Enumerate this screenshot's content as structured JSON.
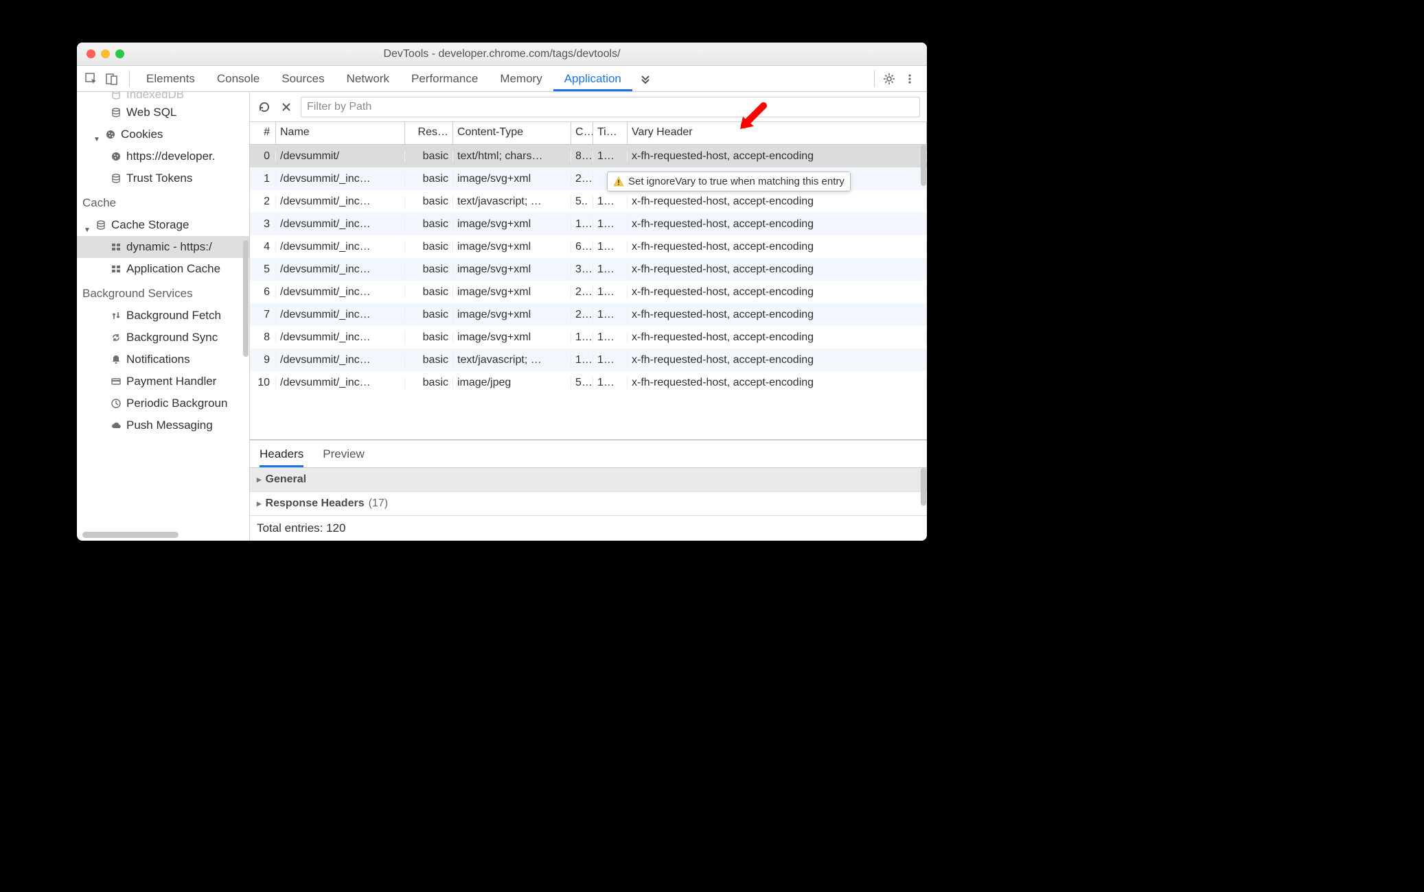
{
  "window_title": "DevTools - developer.chrome.com/tags/devtools/",
  "tabs": [
    "Elements",
    "Console",
    "Sources",
    "Network",
    "Performance",
    "Memory",
    "Application"
  ],
  "active_tab": "Application",
  "sidebar": {
    "truncated_top": "IndexedDB",
    "items_storage": [
      {
        "icon": "db",
        "label": "Web SQL"
      },
      {
        "icon": "cookie",
        "label": "Cookies",
        "expandable": true,
        "children": [
          {
            "icon": "cookie",
            "label": "https://developer."
          }
        ]
      },
      {
        "icon": "db",
        "label": "Trust Tokens"
      }
    ],
    "section_cache": "Cache",
    "cache_items": [
      {
        "icon": "db",
        "label": "Cache Storage",
        "expandable": true,
        "children": [
          {
            "icon": "grid",
            "label": "dynamic - https:/",
            "selected": true
          }
        ]
      },
      {
        "icon": "grid",
        "label": "Application Cache"
      }
    ],
    "section_bg": "Background Services",
    "bg_items": [
      {
        "icon": "updown",
        "label": "Background Fetch"
      },
      {
        "icon": "sync",
        "label": "Background Sync"
      },
      {
        "icon": "bell",
        "label": "Notifications"
      },
      {
        "icon": "card",
        "label": "Payment Handler"
      },
      {
        "icon": "clock",
        "label": "Periodic Backgroun"
      },
      {
        "icon": "cloud",
        "label": "Push Messaging"
      }
    ]
  },
  "filter_placeholder": "Filter by Path",
  "columns": [
    "#",
    "Name",
    "Res…",
    "Content-Type",
    "C..",
    "Ti…",
    "Vary Header"
  ],
  "rows": [
    {
      "n": "0",
      "name": "/devsummit/",
      "res": "basic",
      "ct": "text/html; chars…",
      "c": "8…",
      "t": "1…",
      "vary": "x-fh-requested-host, accept-encoding",
      "sel": true
    },
    {
      "n": "1",
      "name": "/devsummit/_inc…",
      "res": "basic",
      "ct": "image/svg+xml",
      "c": "2…",
      "t": "",
      "vary": ""
    },
    {
      "n": "2",
      "name": "/devsummit/_inc…",
      "res": "basic",
      "ct": "text/javascript; …",
      "c": "5..",
      "t": "1…",
      "vary": "x-fh-requested-host, accept-encoding"
    },
    {
      "n": "3",
      "name": "/devsummit/_inc…",
      "res": "basic",
      "ct": "image/svg+xml",
      "c": "1…",
      "t": "1…",
      "vary": "x-fh-requested-host, accept-encoding"
    },
    {
      "n": "4",
      "name": "/devsummit/_inc…",
      "res": "basic",
      "ct": "image/svg+xml",
      "c": "6…",
      "t": "1…",
      "vary": "x-fh-requested-host, accept-encoding"
    },
    {
      "n": "5",
      "name": "/devsummit/_inc…",
      "res": "basic",
      "ct": "image/svg+xml",
      "c": "3…",
      "t": "1…",
      "vary": "x-fh-requested-host, accept-encoding"
    },
    {
      "n": "6",
      "name": "/devsummit/_inc…",
      "res": "basic",
      "ct": "image/svg+xml",
      "c": "2…",
      "t": "1…",
      "vary": "x-fh-requested-host, accept-encoding"
    },
    {
      "n": "7",
      "name": "/devsummit/_inc…",
      "res": "basic",
      "ct": "image/svg+xml",
      "c": "2…",
      "t": "1…",
      "vary": "x-fh-requested-host, accept-encoding"
    },
    {
      "n": "8",
      "name": "/devsummit/_inc…",
      "res": "basic",
      "ct": "image/svg+xml",
      "c": "1…",
      "t": "1…",
      "vary": "x-fh-requested-host, accept-encoding"
    },
    {
      "n": "9",
      "name": "/devsummit/_inc…",
      "res": "basic",
      "ct": "text/javascript; …",
      "c": "1…",
      "t": "1…",
      "vary": "x-fh-requested-host, accept-encoding"
    },
    {
      "n": "10",
      "name": "/devsummit/_inc…",
      "res": "basic",
      "ct": "image/jpeg",
      "c": "5…",
      "t": "1…",
      "vary": "x-fh-requested-host, accept-encoding"
    }
  ],
  "tooltip": "Set ignoreVary to true when matching this entry",
  "details": {
    "tabs": [
      "Headers",
      "Preview"
    ],
    "active": "Headers",
    "sections": {
      "general": "General",
      "response": "Response Headers",
      "response_count": "(17)"
    },
    "footer": "Total entries: 120"
  }
}
